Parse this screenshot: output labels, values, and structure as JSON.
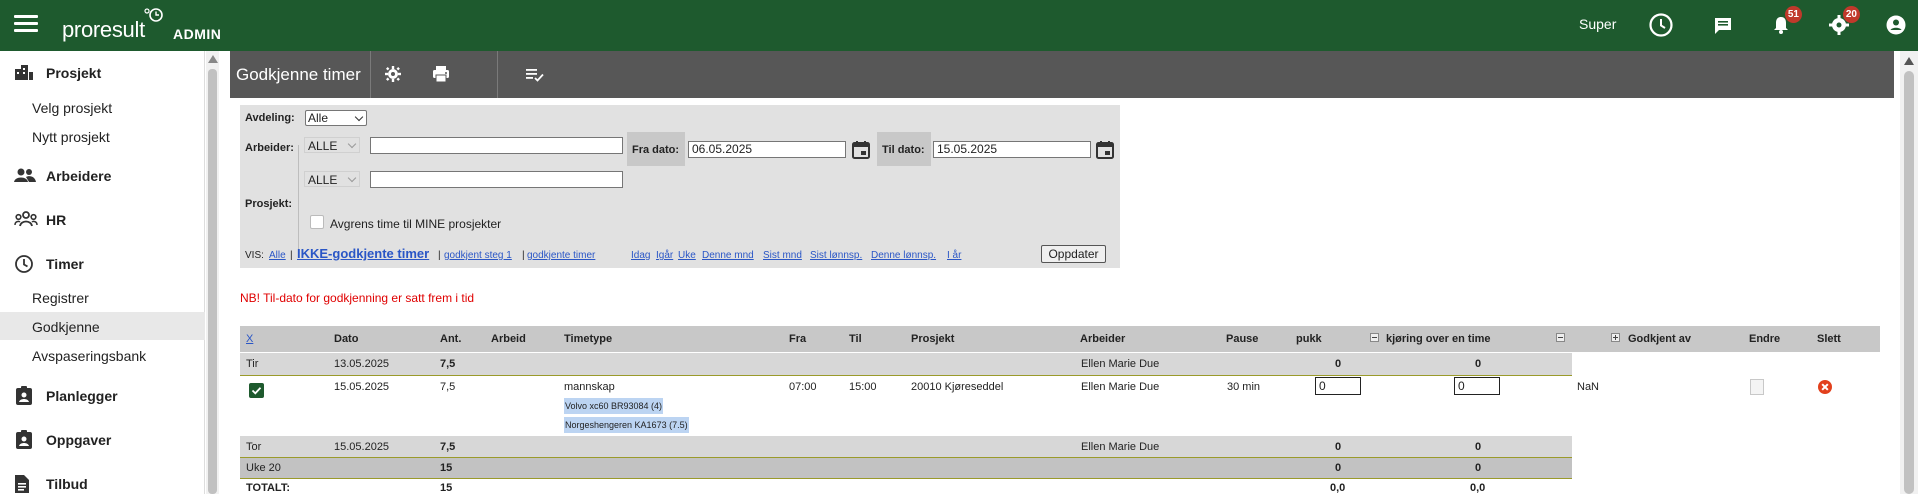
{
  "app": {
    "logo_text": "proresult",
    "admin_label": "ADMIN",
    "user_name": "Super",
    "notification_count": "51",
    "settings_count": "20"
  },
  "sidebar": {
    "items": [
      {
        "label": "Prosjekt",
        "icon": "building-icon"
      },
      {
        "label": "Velg prosjekt"
      },
      {
        "label": "Nytt prosjekt"
      },
      {
        "label": "Arbeidere",
        "icon": "people-icon"
      },
      {
        "label": "HR",
        "icon": "group-icon"
      },
      {
        "label": "Timer",
        "icon": "clock-icon"
      },
      {
        "label": "Registrer"
      },
      {
        "label": "Godkjenne"
      },
      {
        "label": "Avspaseringsbank"
      },
      {
        "label": "Planlegger",
        "icon": "clipboard-person-icon"
      },
      {
        "label": "Oppgaver",
        "icon": "clipboard-person-icon"
      },
      {
        "label": "Tilbud",
        "icon": "document-icon"
      }
    ]
  },
  "page": {
    "title": "Godkjenne timer"
  },
  "filter": {
    "avdeling_label": "Avdeling:",
    "avdeling_value": "Alle",
    "arbeider_label": "Arbeider:",
    "arbeider_select": "ALLE",
    "arbeider_text": "",
    "fra_dato_label": "Fra dato:",
    "fra_dato_value": "06.05.2025",
    "til_dato_label": "Til dato:",
    "til_dato_value": "15.05.2025",
    "prosjekt_label": "Prosjekt:",
    "prosjekt_select": "ALLE",
    "prosjekt_text": "",
    "restrict_label": "Avgrens time til MINE prosjekter",
    "vis_label": "VIS:",
    "vis_alle": "Alle",
    "vis_ikke": "IKKE-godkjente timer",
    "vis_steg1": "godkjent steg 1",
    "vis_godkjente": "godkjente timer",
    "periods": [
      "Idag",
      "Igår",
      "Uke",
      "Denne mnd",
      "Sist mnd",
      "Sist lønnsp.",
      "Denne lønnsp.",
      "I år"
    ],
    "update_button": "Oppdater"
  },
  "warning": "NB! Til-dato for godkjenning er satt frem i tid",
  "table": {
    "headers": {
      "x": "X",
      "dato": "Dato",
      "ant": "Ant.",
      "arbeid": "Arbeid",
      "timetype": "Timetype",
      "fra": "Fra",
      "til": "Til",
      "prosjekt": "Prosjekt",
      "arbeider": "Arbeider",
      "pause": "Pause",
      "pukk": "pukk",
      "kjoring": "kjøring over en time",
      "godkjent_av": "Godkjent av",
      "endre": "Endre",
      "slett": "Slett"
    },
    "day_row_1": {
      "day": "Tir",
      "dato": "13.05.2025",
      "ant": "7,5",
      "arbeider": "Ellen Marie Due",
      "pukk": "0",
      "kjoring": "0"
    },
    "entry": {
      "dato": "15.05.2025",
      "ant": "7,5",
      "timetype": "mannskap",
      "fra": "07:00",
      "til": "15:00",
      "prosjekt": "20010 Kjøreseddel",
      "arbeider": "Ellen Marie Due",
      "pause": "30 min",
      "pukk_value": "0",
      "kjoring_value": "0",
      "godkjent_av": "NaN",
      "vehicles": [
        "Volvo xc60 BR93084 (4)",
        "Norgeshengeren KA1673 (7.5)"
      ]
    },
    "day_row_2": {
      "day": "Tor",
      "dato": "15.05.2025",
      "ant": "7,5",
      "arbeider": "Ellen Marie Due",
      "pukk": "0",
      "kjoring": "0"
    },
    "week_row": {
      "label": "Uke 20",
      "ant": "15",
      "pukk": "0",
      "kjoring": "0"
    },
    "total_row": {
      "label": "TOTALT:",
      "ant": "15",
      "pukk": "0,0",
      "kjoring": "0,0"
    }
  },
  "colors": {
    "header_green": "#1e5a2e",
    "toolbar_grey": "#575757",
    "badge_red": "#c0392b",
    "warning_red": "#e00000"
  }
}
